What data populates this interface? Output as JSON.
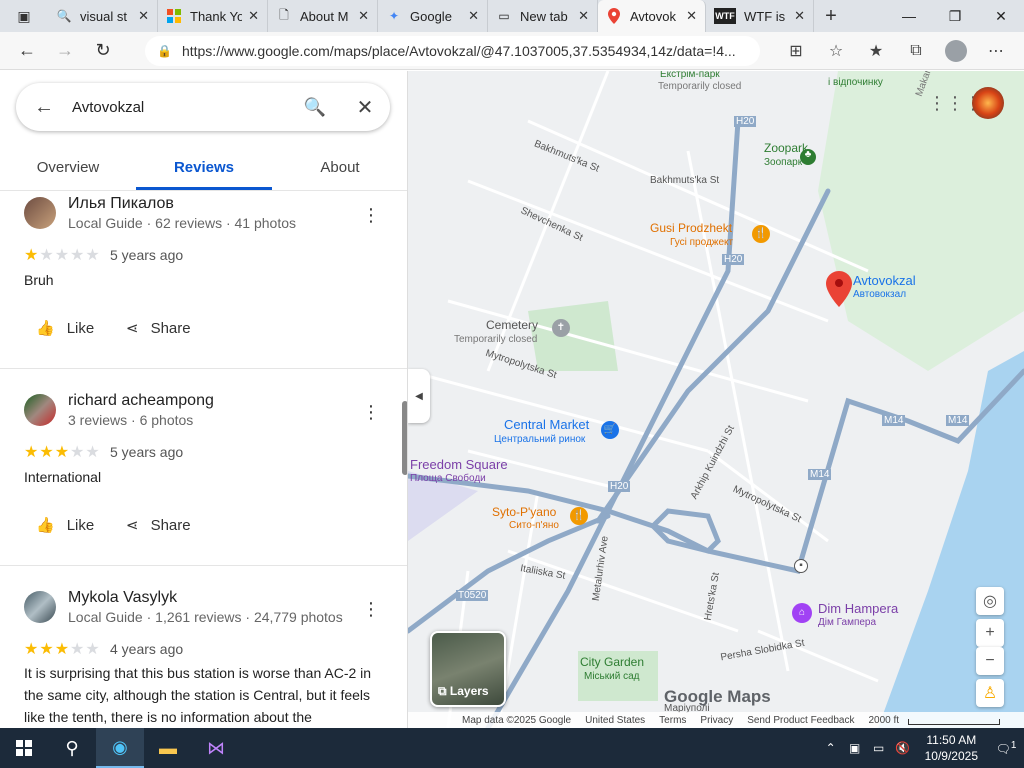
{
  "tabs": [
    {
      "title": "visual st",
      "icon": "search-icon"
    },
    {
      "title": "Thank Yo",
      "icon": "microsoft-icon"
    },
    {
      "title": "About M",
      "icon": "document-icon"
    },
    {
      "title": "Google",
      "icon": "gemini-icon"
    },
    {
      "title": "New tab",
      "icon": "newtab-icon"
    },
    {
      "title": "Avtovok",
      "icon": "maps-icon"
    },
    {
      "title": "WTF is ",
      "icon": "wtf-icon"
    }
  ],
  "address": {
    "url": "https://www.google.com/maps/place/Avtovokzal/@47.1037005,37.5354934,14z/data=!4..."
  },
  "search": {
    "query": "Avtovokzal"
  },
  "place_tabs": [
    "Overview",
    "Reviews",
    "About"
  ],
  "reviews": [
    {
      "name": "Илья Пикалов",
      "meta": "Local Guide · 62 reviews · 41 photos",
      "stars": 1,
      "ago": "5 years ago",
      "text": "Bruh"
    },
    {
      "name": "richard acheampong",
      "meta": "3 reviews · 6 photos",
      "stars": 3,
      "ago": "5 years ago",
      "text": "International"
    },
    {
      "name": "Mykola Vasylyk",
      "meta": "Local Guide · 1,261 reviews · 24,779 photos",
      "stars": 3,
      "ago": "4 years ago",
      "text": "It is surprising that this bus station is worse than AC-2 in the same city, although the station is Central, but it feels like the tenth, there is no information about the"
    }
  ],
  "actions": {
    "like": "Like",
    "share": "Share"
  },
  "map": {
    "labels": {
      "ekstrim": "Екстрім-парк",
      "temp_closed_top": "Temporarily closed",
      "culture": "і відпочинку",
      "makara": "Makara",
      "zoopark_en": "Zoopark",
      "zoopark_ua": "Зоопарк",
      "bakhmutska1": "Bakhmuts'ka St",
      "bakhmutska2": "Bakhmuts'ka St",
      "shevchenka": "Shevchenka St",
      "gusi_en": "Gusi Prodzhekt",
      "gusi_ua": "Гусі проджект",
      "avtovokzal_en": "Avtovokzal",
      "avtovokzal_ua": "Автовокзал",
      "cemetery": "Cemetery",
      "cemetery_closed": "Temporarily closed",
      "mytropolytska": "Mytropolytska St",
      "central_market_en": "Central Market",
      "central_market_ua": "Центральний ринок",
      "freedom_en": "Freedom Square",
      "freedom_ua": "Площа Свободи",
      "syto_en": "Syto-P'yano",
      "syto_ua": "Сито-п'яно",
      "arkhip": "Arkhip Kuindzhi St",
      "mytropolytska2": "Mytropolytska St",
      "italiiska": "Italiiska St",
      "metalurhiv": "Metalurhiv Ave",
      "hretska": "Hrets'ka St",
      "dim_en": "Dim Hampera",
      "dim_ua": "Дім Гампера",
      "city_garden_en": "City Garden",
      "city_garden_ua": "Міський сад",
      "persha": "Persha Slobidka St",
      "manuori": "Маріуполі",
      "h20a": "H20",
      "h20b": "H20",
      "h20c": "H20",
      "m14a": "M14",
      "m14b": "M14",
      "m14c": "M14",
      "t0520": "T0520"
    },
    "layers_label": "Layers",
    "brand": "Google Maps",
    "footer": [
      "Map data ©2025 Google",
      "United States",
      "Terms",
      "Privacy",
      "Send Product Feedback",
      "2000 ft"
    ]
  },
  "taskbar": {
    "time": "11:50 AM",
    "date": "10/9/2025",
    "notifications": "1"
  }
}
